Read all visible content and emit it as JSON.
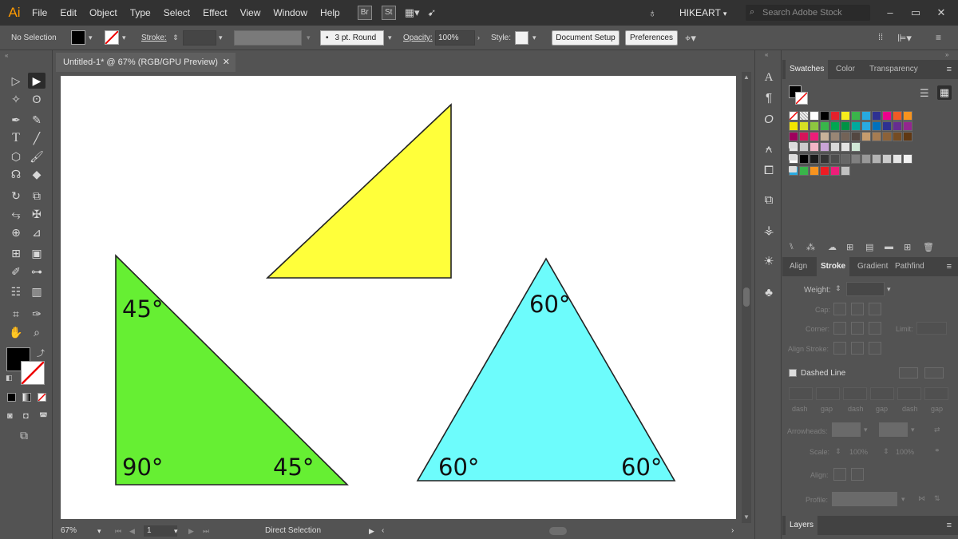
{
  "app": {
    "logo": "Ai",
    "menus": [
      "File",
      "Edit",
      "Object",
      "Type",
      "Select",
      "Effect",
      "View",
      "Window",
      "Help"
    ],
    "bridge_labels": [
      "Br",
      "St"
    ],
    "workspace": "HIKEART",
    "search_placeholder": "Search Adobe Stock"
  },
  "control": {
    "selection": "No Selection",
    "stroke_label": "Stroke:",
    "brush": "3 pt. Round",
    "opacity_label": "Opacity:",
    "opacity_value": "100%",
    "style_label": "Style:",
    "document_setup": "Document Setup",
    "preferences": "Preferences"
  },
  "document": {
    "tab_title": "Untitled-1* @ 67% (RGB/GPU Preview)",
    "zoom": "67%",
    "artboard_number": "1",
    "status_tool": "Direct Selection"
  },
  "shapes": [
    {
      "id": "yellow",
      "fill": "#ffff3a",
      "labels": []
    },
    {
      "id": "green",
      "fill": "#66ef33",
      "labels": [
        "45°",
        "90°",
        "45°"
      ]
    },
    {
      "id": "cyan",
      "fill": "#6dfcfc",
      "labels": [
        "60°",
        "60°",
        "60°"
      ]
    }
  ],
  "swatches_panel": {
    "tabs": [
      "Swatches",
      "Color",
      "Transparency"
    ]
  },
  "stroke_panel": {
    "tabs": [
      "Align",
      "Stroke",
      "Gradient",
      "Pathfind"
    ],
    "weight_label": "Weight:",
    "cap_label": "Cap:",
    "corner_label": "Corner:",
    "limit_label": "Limit:",
    "align_label": "Align Stroke:",
    "dashed_label": "Dashed Line",
    "dash_labels": [
      "dash",
      "gap",
      "dash",
      "gap",
      "dash",
      "gap"
    ],
    "arrowheads_label": "Arrowheads:",
    "scale_label": "Scale:",
    "scale_values": [
      "100%",
      "100%"
    ],
    "align2_label": "Align:",
    "profile_label": "Profile:"
  },
  "layers_panel": {
    "tab": "Layers"
  },
  "colors": {
    "chrome_dark": "#323232",
    "chrome": "#535353",
    "artboard": "#ffffff",
    "accent_logo": "#ff9a00"
  }
}
